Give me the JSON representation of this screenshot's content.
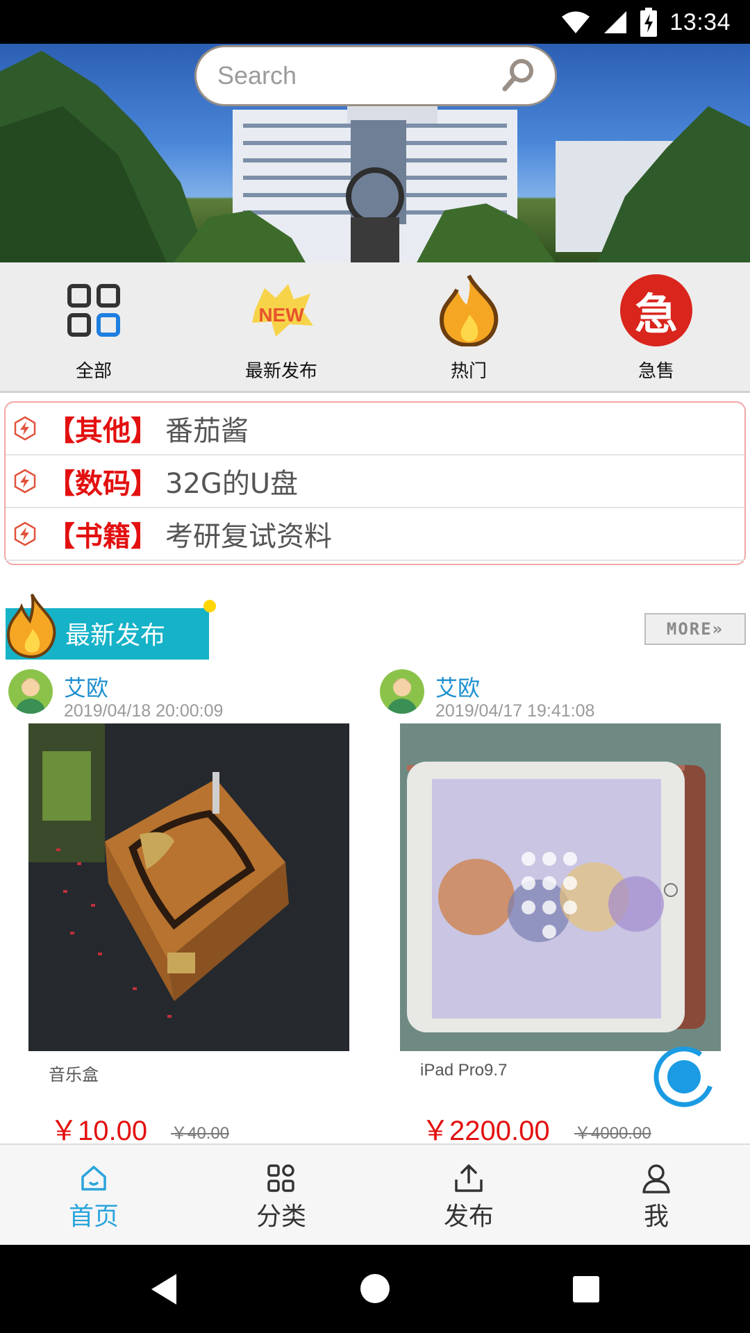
{
  "status_bar": {
    "time": "13:34"
  },
  "search": {
    "placeholder": "Search"
  },
  "categories": [
    {
      "label": "全部",
      "icon": "grid-icon"
    },
    {
      "label": "最新发布",
      "icon": "new-badge-icon"
    },
    {
      "label": "热门",
      "icon": "flame-icon"
    },
    {
      "label": "急售",
      "icon": "urgent-icon",
      "icon_text": "急"
    }
  ],
  "notices": [
    {
      "category": "【其他】",
      "title": "番茄酱"
    },
    {
      "category": "【数码】",
      "title": "32G的U盘"
    },
    {
      "category": "【书籍】",
      "title": "考研复试资料"
    }
  ],
  "section": {
    "title": "最新发布",
    "more_label": "MORE»"
  },
  "products": [
    {
      "author": "艾欧",
      "time": "2019/04/18 20:00:09",
      "name": "音乐盒",
      "price": "￥10.00",
      "old_price": "￥40.00"
    },
    {
      "author": "艾欧",
      "time": "2019/04/17 19:41:08",
      "name": "iPad Pro9.7",
      "price": "￥2200.00",
      "old_price": "￥4000.00"
    }
  ],
  "bottom_nav": [
    {
      "label": "首页",
      "icon": "home-icon",
      "active": true
    },
    {
      "label": "分类",
      "icon": "category-icon",
      "active": false
    },
    {
      "label": "发布",
      "icon": "upload-icon",
      "active": false
    },
    {
      "label": "我",
      "icon": "profile-icon",
      "active": false
    }
  ],
  "colors": {
    "accent": "#2aa4dc",
    "price_red": "#e31010",
    "section_teal": "#16b2c8",
    "notice_border": "#f2a6a6"
  }
}
